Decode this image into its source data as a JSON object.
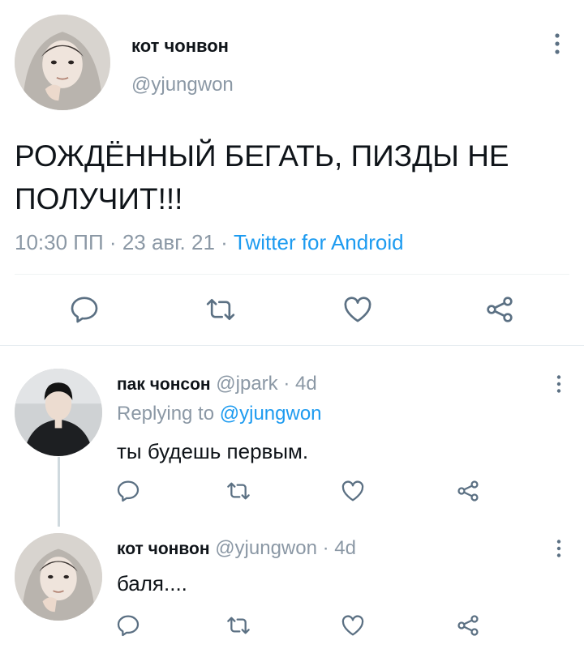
{
  "main_tweet": {
    "display_name": "кот чонвон",
    "handle": "@yjungwon",
    "text": "РОЖДЁННЫЙ БЕГАТЬ, ПИЗДЫ НЕ ПОЛУЧИТ!!!",
    "time": "10:30 ПП",
    "separator": "·",
    "date": "23 авг. 21",
    "source": "Twitter for Android"
  },
  "replies": [
    {
      "display_name": "пак чонсон",
      "handle": "@jpark",
      "separator": "·",
      "age": "4d",
      "replying_prefix": "Replying to",
      "replying_to": "@yjungwon",
      "text": "ты будешь первым."
    },
    {
      "display_name": "кот чонвон",
      "handle": "@yjungwon",
      "separator": "·",
      "age": "4d",
      "text": "баля...."
    }
  ],
  "icons": [
    "more-icon",
    "reply-icon",
    "retweet-icon",
    "like-icon",
    "share-icon"
  ],
  "colors": {
    "accent": "#1d9bf0",
    "muted": "#8b98a5",
    "text": "#0f1419",
    "divider": "#eff3f4",
    "icon": "#5b7083"
  }
}
